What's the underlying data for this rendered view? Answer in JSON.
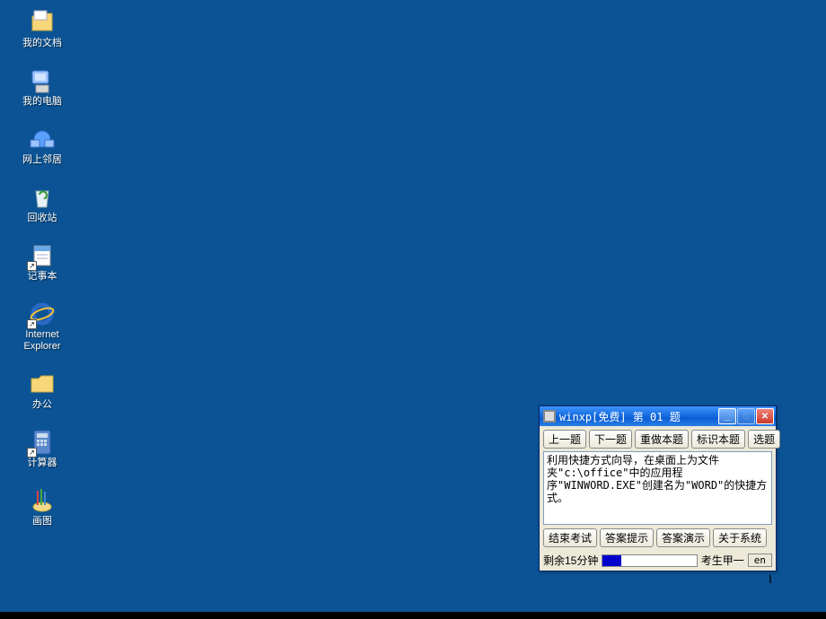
{
  "desktop": {
    "icons": [
      {
        "label": "我的文档",
        "glyph": "folder-docs",
        "shortcut": false
      },
      {
        "label": "我的电脑",
        "glyph": "my-computer",
        "shortcut": false
      },
      {
        "label": "网上邻居",
        "glyph": "network",
        "shortcut": false
      },
      {
        "label": "回收站",
        "glyph": "recycle-bin",
        "shortcut": false
      },
      {
        "label": "记事本",
        "glyph": "notepad",
        "shortcut": true
      },
      {
        "label": "Internet\nExplorer",
        "glyph": "ie",
        "shortcut": true
      },
      {
        "label": "办公",
        "glyph": "folder",
        "shortcut": false
      },
      {
        "label": "计算器",
        "glyph": "calculator",
        "shortcut": true
      },
      {
        "label": "画图",
        "glyph": "paint",
        "shortcut": false
      }
    ]
  },
  "exam_window": {
    "title": "winxp[免费] 第 01 题",
    "toolbar": {
      "prev": "上一题",
      "next": "下一题",
      "redo": "重做本题",
      "mark": "标识本题",
      "select": "选题"
    },
    "question_text": "利用快捷方式向导，在桌面上为文件夹\"c:\\office\"中的应用程序\"WINWORD.EXE\"创建名为\"WORD\"的快捷方式。",
    "bottom": {
      "end_exam": "结束考试",
      "hint": "答案提示",
      "demo": "答案演示",
      "about": "关于系统"
    },
    "status": {
      "time_remaining": "剩余15分钟",
      "candidate": "考生甲一",
      "lang": "en",
      "progress_percent": 20
    }
  }
}
